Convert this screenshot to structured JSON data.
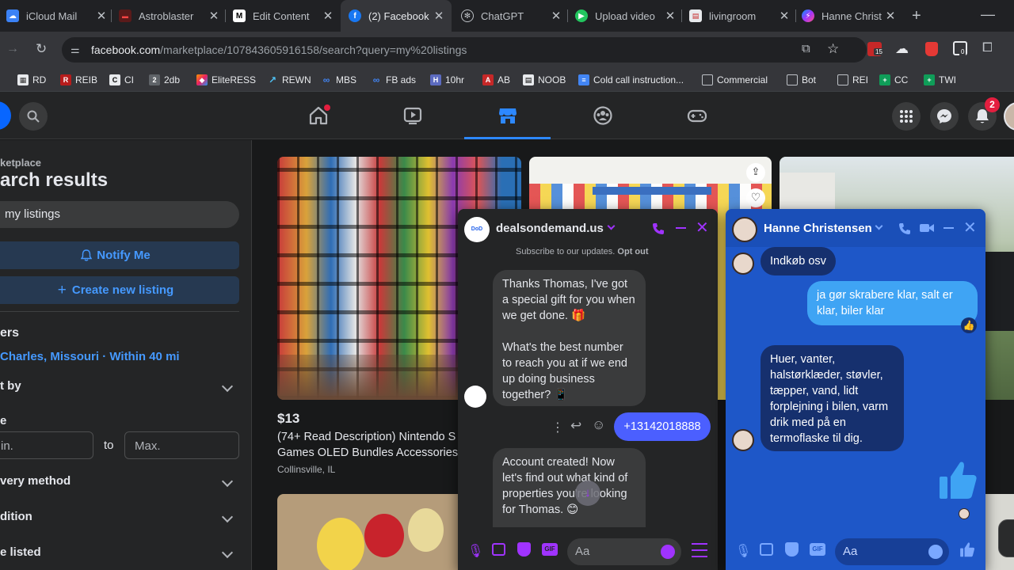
{
  "browser": {
    "tabs": [
      {
        "title": "iCloud Mail",
        "icon": "cloud-icon",
        "active": false
      },
      {
        "title": "Astroblaster",
        "icon": "game-icon",
        "active": false
      },
      {
        "title": "Edit Content",
        "icon": "m-logo-icon",
        "active": false
      },
      {
        "title": "(2) Facebook",
        "icon": "facebook-icon",
        "active": true
      },
      {
        "title": "ChatGPT",
        "icon": "openai-icon",
        "active": false
      },
      {
        "title": "Upload video",
        "icon": "play-icon",
        "active": false
      },
      {
        "title": "livingroom",
        "icon": "photo-icon",
        "active": false
      },
      {
        "title": "Hanne Christ",
        "icon": "messenger-icon",
        "active": false
      }
    ],
    "url_host": "facebook.com",
    "url_path": "/marketplace/107843605916158/search?query=my%20listings",
    "extension_badge_1": "15",
    "extension_badge_2": "0",
    "bookmarks": [
      {
        "label": "RD"
      },
      {
        "label": "REIB"
      },
      {
        "label": "CI"
      },
      {
        "label": "2db"
      },
      {
        "label": "EliteRESS"
      },
      {
        "label": "REWN"
      },
      {
        "label": "MBS"
      },
      {
        "label": "FB ads"
      },
      {
        "label": "10hr"
      },
      {
        "label": "AB"
      },
      {
        "label": "NOOB"
      },
      {
        "label": "Cold call instruction..."
      },
      {
        "label": "Commercial"
      },
      {
        "label": "Bot"
      },
      {
        "label": "REI"
      },
      {
        "label": "CC"
      },
      {
        "label": "TWI"
      }
    ]
  },
  "fbnav": {
    "notification_count": "2"
  },
  "sidebar": {
    "crumb": "ketplace",
    "title": "arch results",
    "search_value": "my listings",
    "notify_label": "Notify Me",
    "create_label": "Create new listing",
    "filters_heading": "ers",
    "location": "Charles, Missouri · Within 40 mi",
    "sort_label": "t by",
    "price_label": "e",
    "min_placeholder": "in.",
    "to_label": "to",
    "max_placeholder": "Max.",
    "delivery_label": "very method",
    "condition_label": "dition",
    "date_label": "e listed"
  },
  "listings": [
    {
      "price": "$13",
      "title_line1": "(74+ Read Description) Nintendo S",
      "title_line2": "Games OLED Bundles Accessories",
      "location": "Collinsville, IL"
    }
  ],
  "chat_deals": {
    "name": "dealsondemand.us",
    "avatar_text": "DoD",
    "subscribe_text": "Subscribe to our updates.",
    "opt_out": "Opt out",
    "msg1_lines": [
      "Thanks Thomas, I've got",
      "a special gift for you when",
      "we get done. 🎁",
      "",
      "What's the best number",
      "to reach you at if we end",
      "up doing business",
      "together? 📱"
    ],
    "reply": "+13142018888",
    "msg2_lines": [
      "Account created!  Now",
      "let's find out what kind of",
      "properties you're looking",
      "for Thomas. 😊"
    ],
    "composer_placeholder": "Aa"
  },
  "chat_hanne": {
    "name": "Hanne Christensen",
    "msg1": "Indkøb osv",
    "msg2_lines": [
      "ja gør skrabere klar, salt er",
      "klar, biler klar"
    ],
    "reaction": "👍",
    "msg3_lines": [
      "Huer, vanter,",
      "halstørklæder, støvler,",
      "tæpper, vand, lidt",
      "forplejning i bilen, varm",
      "drik med på en",
      "termoflaske til dig."
    ],
    "composer_placeholder": "Aa"
  },
  "colors": {
    "fb_blue": "#2d88ff",
    "messenger_blue": "#0866ff",
    "chat_blue_bg": "#1e57c8",
    "send_bubble": "#3b82f6",
    "dark_bg": "#18191a",
    "panel": "#242526",
    "bubble_gray": "#3a3b3c",
    "notify_bg": "#263951",
    "purple_accent": "#a033ff",
    "reply_blue": "#4b5fff"
  }
}
